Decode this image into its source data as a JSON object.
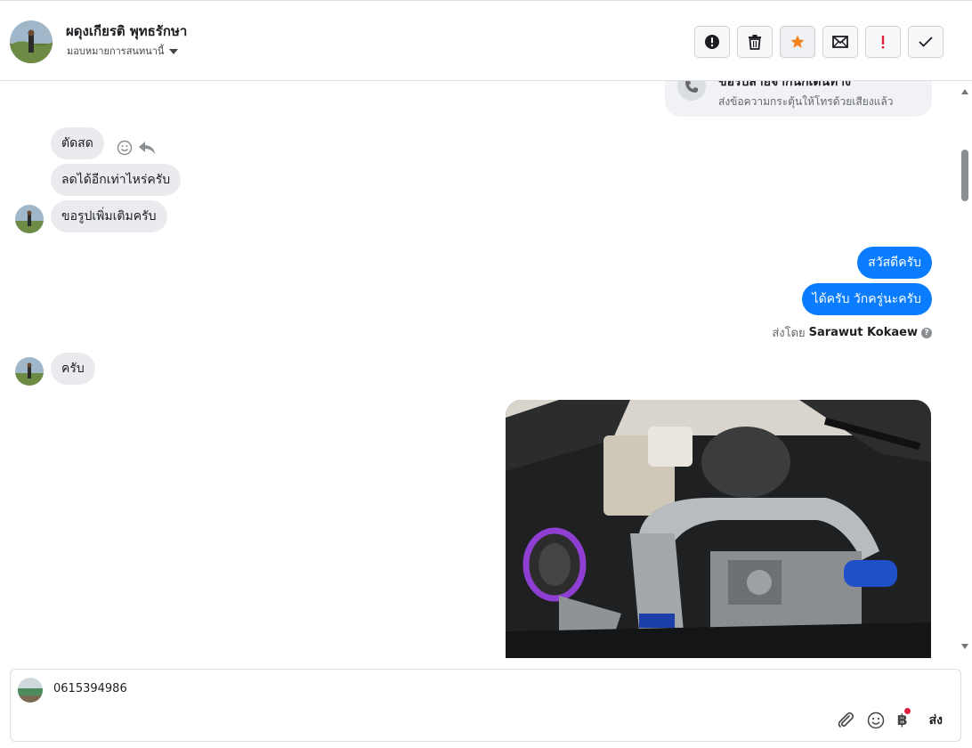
{
  "header": {
    "contact_name": "ผดุงเกียรติ พุทธรักษา",
    "assign_label": "มอบหมายการสนทนานี้",
    "actions": [
      {
        "name": "report-spam-icon",
        "color": "#1c1e21"
      },
      {
        "name": "trash-icon",
        "color": "#1c1e21"
      },
      {
        "name": "star-icon",
        "color": "#f5821f"
      },
      {
        "name": "envelope-icon",
        "color": "#1c1e21"
      },
      {
        "name": "follow-up-icon",
        "color": "#e41e3f"
      },
      {
        "name": "checkmark-icon",
        "color": "#1c1e21"
      }
    ]
  },
  "thread": {
    "system_card": {
      "title": "ขอรับสายจากนักเดินทาง",
      "subtitle": "ส่งข้อความกระตุ้นให้โทรด้วยเสียงแล้ว"
    },
    "messages": [
      {
        "from": "them",
        "text": "ตัดสด"
      },
      {
        "from": "them",
        "text": "ลดได้อีกเท่าไหร่ครับ"
      },
      {
        "from": "them",
        "text": "ขอรูปเพิ่มเติมครับ"
      },
      {
        "from": "me",
        "text": "สวัสดีครับ"
      },
      {
        "from": "me",
        "text": "ได้ครับ วักครู่นะครับ"
      },
      {
        "from": "them",
        "text": "ครับ"
      }
    ],
    "sent_by_label": "ส่งโดย",
    "sent_by_name": "Sarawut Kokaew",
    "help_glyph": "?"
  },
  "composer": {
    "text": "0615394986",
    "send_label": "ส่ง",
    "currency_glyph": "฿"
  },
  "colors": {
    "outgoing_bubble": "#0a7cff",
    "incoming_bubble": "#e9ebee",
    "accent_star": "#f5821f",
    "alert": "#e41e3f"
  }
}
